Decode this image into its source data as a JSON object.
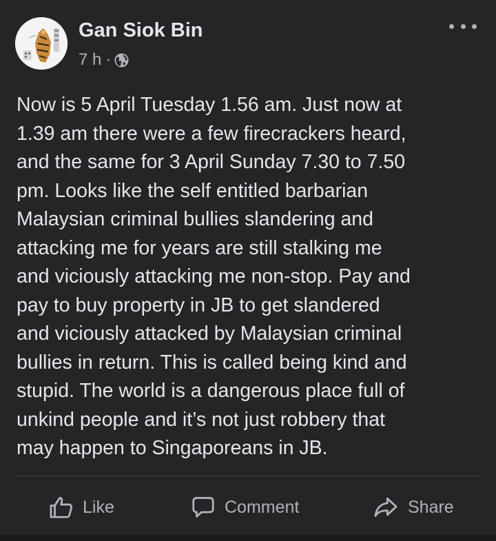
{
  "post": {
    "author": "Gan Siok Bin",
    "time": "7 h",
    "separator": "·",
    "privacy_icon": "globe-icon",
    "lines": [
      "Now is 5 April Tuesday 1.56 am. Just now at",
      "1.39 am there were a few firecrackers heard,",
      "and the same for 3 April Sunday 7.30 to 7.50",
      "pm. Looks like the self entitled barbarian",
      "Malaysian criminal bullies slandering and",
      "attacking me for years are still stalking me",
      "and viciously attacking me non-stop. Pay and",
      "pay to buy property in JB to get slandered",
      "and viciously attacked by Malaysian criminal",
      "bullies in return. This is called being kind and",
      "stupid. The world is a dangerous place full of",
      "unkind people and it’s not just robbery that",
      "may happen to Singaporeans in JB."
    ]
  },
  "actions": {
    "like": "Like",
    "comment": "Comment",
    "share": "Share"
  },
  "colors": {
    "background": "#242526",
    "text": "#e4e6eb",
    "secondary_text": "#b0b3b8"
  }
}
